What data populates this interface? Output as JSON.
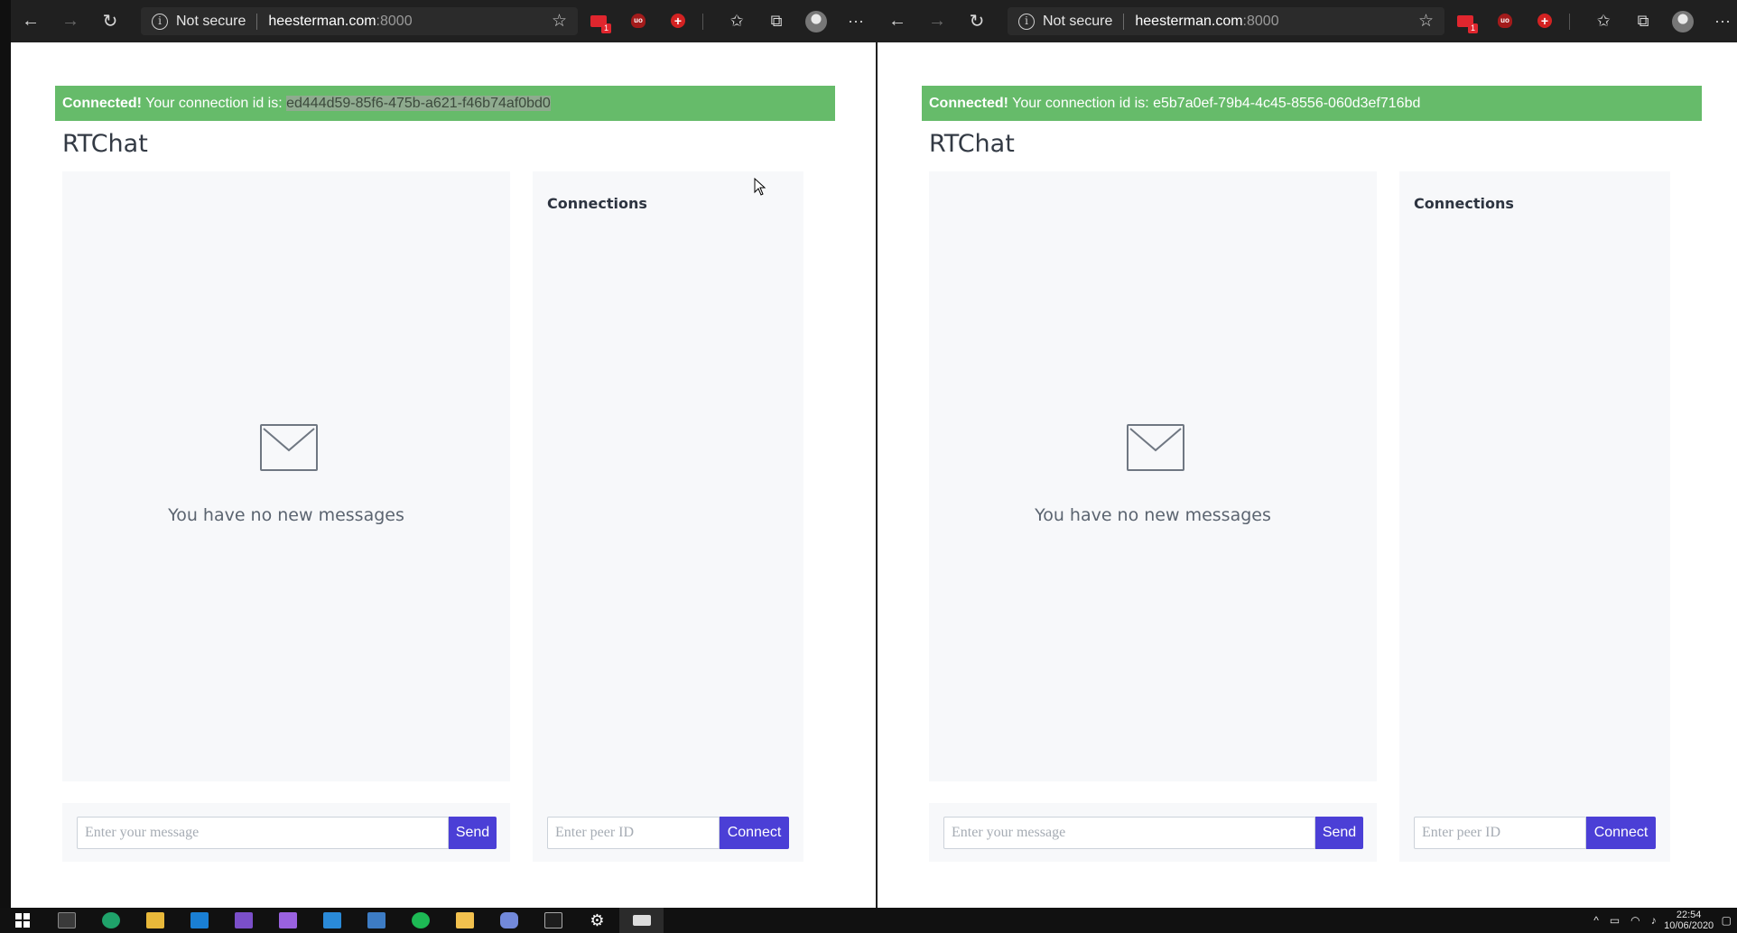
{
  "browser": {
    "security_label": "Not secure",
    "host": "heesterman.com",
    "port": ":8000"
  },
  "app": {
    "connected_label": "Connected!",
    "connection_prefix": " Your connection id is: ",
    "title": "RTChat",
    "empty_message": "You have no new messages",
    "connections_title": "Connections",
    "message_placeholder": "Enter your message",
    "send_label": "Send",
    "peer_placeholder": "Enter peer ID",
    "connect_label": "Connect"
  },
  "windows": [
    {
      "connection_id": "ed444d59-85f6-475b-a621-f46b74af0bd0"
    },
    {
      "connection_id": "e5b7a0ef-79b4-4c45-8556-060d3ef716bd"
    }
  ],
  "taskbar": {
    "time": "22:54",
    "date": "10/06/2020"
  },
  "colors": {
    "alert_green": "#66bb6a",
    "button_purple": "#4b3fd6",
    "panel_bg": "#f7f8fa"
  }
}
